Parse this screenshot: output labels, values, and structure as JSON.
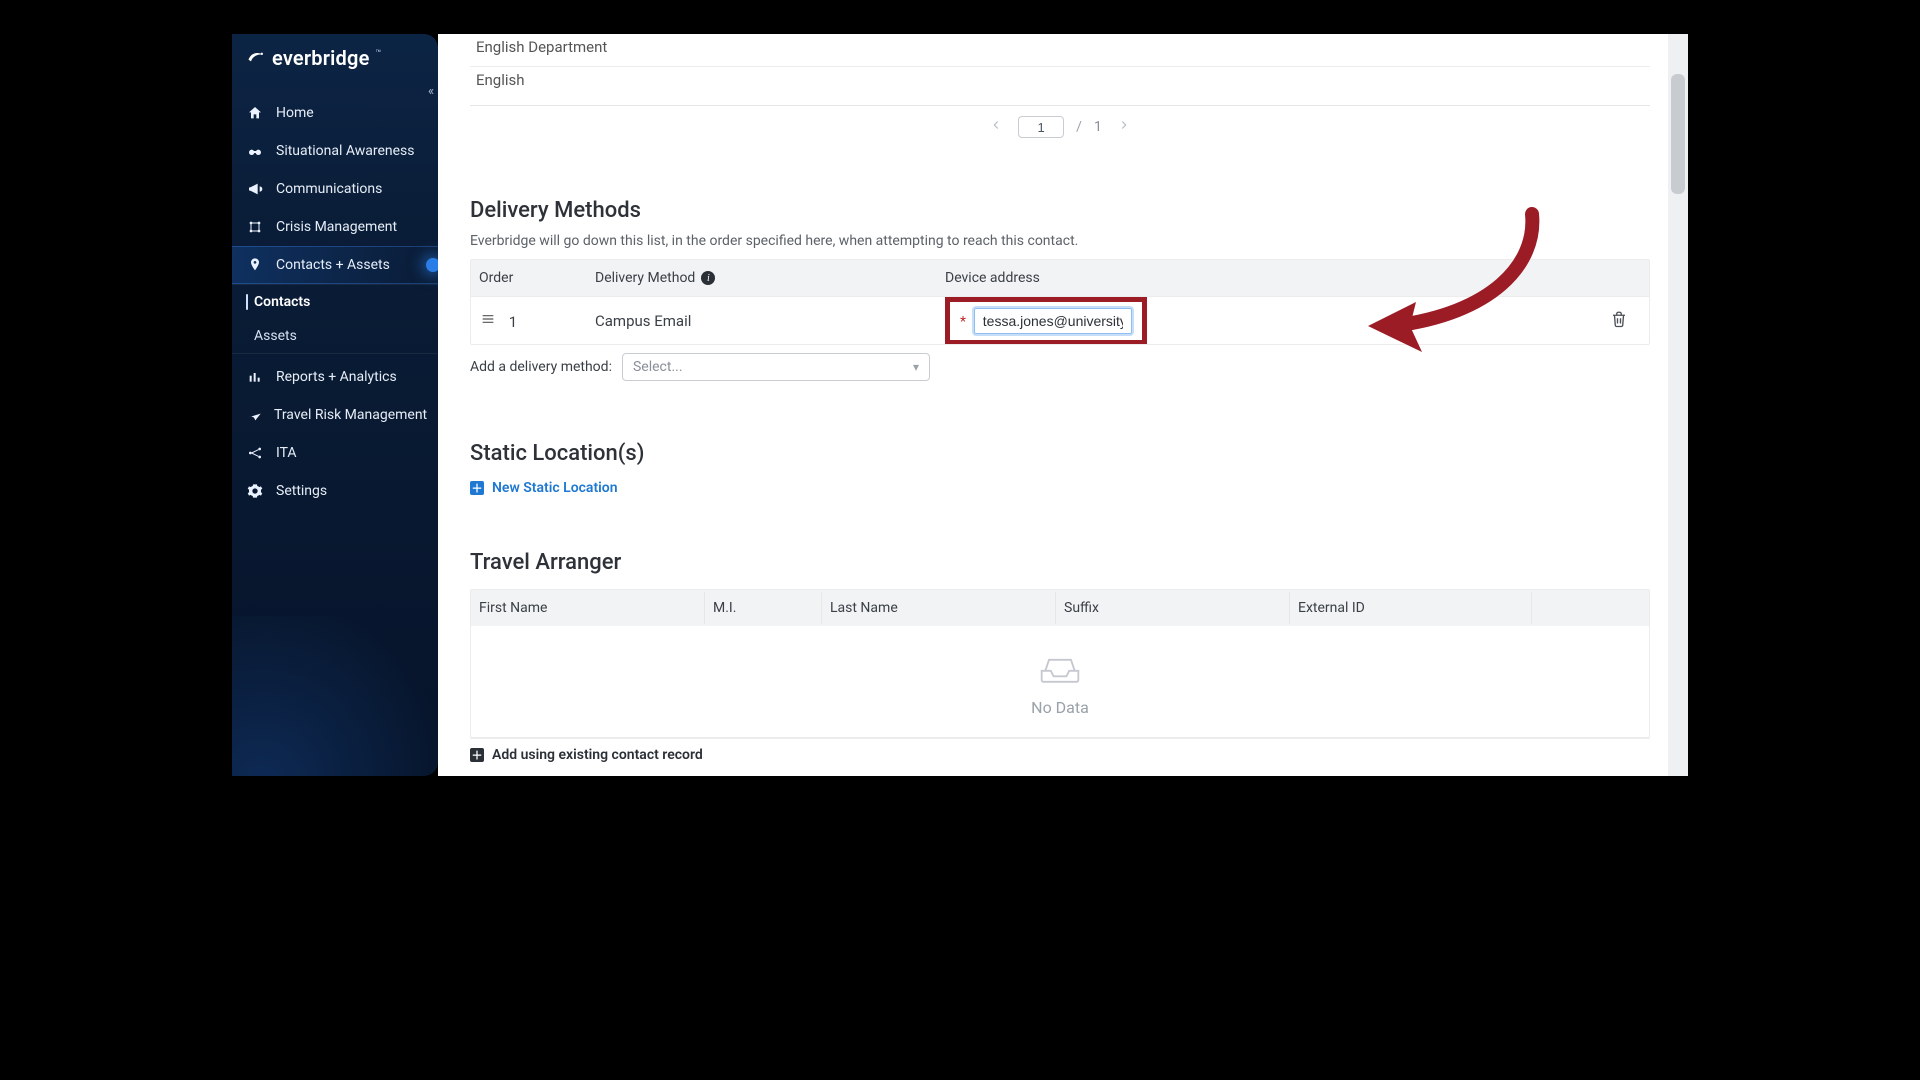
{
  "brand": {
    "name": "everbridge"
  },
  "sidebar": {
    "collapse_glyph": "«",
    "items": [
      {
        "label": "Home"
      },
      {
        "label": "Situational Awareness"
      },
      {
        "label": "Communications"
      },
      {
        "label": "Crisis Management"
      },
      {
        "label": "Contacts + Assets"
      },
      {
        "label": "Reports + Analytics"
      },
      {
        "label": "Travel Risk Management"
      },
      {
        "label": "ITA"
      },
      {
        "label": "Settings"
      }
    ],
    "subitems": [
      {
        "label": "Contacts"
      },
      {
        "label": "Assets"
      }
    ]
  },
  "groups": {
    "rows": [
      {
        "label": "English Department"
      },
      {
        "label": "English"
      }
    ]
  },
  "pager": {
    "page": "1",
    "total": "1",
    "separator": "/"
  },
  "delivery": {
    "title": "Delivery Methods",
    "subtitle": "Everbridge will go down this list, in the order specified here, when attempting to reach this contact.",
    "headers": {
      "order": "Order",
      "method": "Delivery Method",
      "address": "Device address"
    },
    "rows": [
      {
        "order": "1",
        "method": "Campus Email",
        "address": "tessa.jones@university.ed"
      }
    ],
    "add_label": "Add a delivery method:",
    "select_placeholder": "Select..."
  },
  "static_loc": {
    "title": "Static Location(s)",
    "new_link": "New Static Location"
  },
  "travel": {
    "title": "Travel Arranger",
    "headers": {
      "first": "First Name",
      "mi": "M.I.",
      "last": "Last Name",
      "suffix": "Suffix",
      "extid": "External ID"
    },
    "no_data": "No Data",
    "add_existing": "Add using existing contact record"
  },
  "colors": {
    "highlight": "#9c1c26",
    "link": "#1f78d1",
    "sidebar_top": "#0c2444",
    "sidebar_bottom": "#06142a"
  }
}
